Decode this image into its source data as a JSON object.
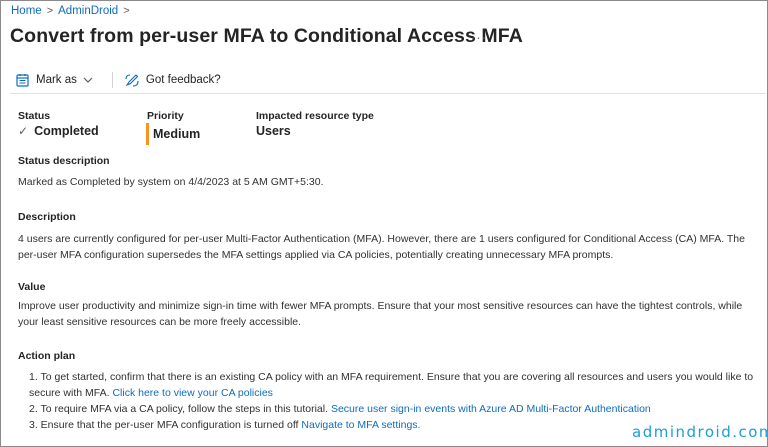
{
  "breadcrumb": {
    "items": [
      "Home",
      "AdminDroid"
    ],
    "separator": ">"
  },
  "header": {
    "title": "Convert from per-user MFA to Conditional Access MFA",
    "more_label": "···"
  },
  "toolbar": {
    "mark_as_label": "Mark as",
    "feedback_label": "Got feedback?"
  },
  "summary": {
    "status_label": "Status",
    "status_value": "Completed",
    "status_check": "✓",
    "priority_label": "Priority",
    "priority_value": "Medium",
    "priority_color": "#f7941d",
    "impacted_label": "Impacted resource type",
    "impacted_value": "Users"
  },
  "status_description": {
    "heading": "Status description",
    "text": "Marked as Completed by system on 4/4/2023 at 5 AM GMT+5:30."
  },
  "description": {
    "heading": "Description",
    "text": "4 users are currently configured for per-user Multi-Factor Authentication (MFA). However, there are 1 users configured for Conditional Access (CA) MFA. The per-user MFA configuration supersedes the MFA settings applied via CA policies, potentially creating unnecessary MFA prompts."
  },
  "value_section": {
    "heading": "Value",
    "text": "Improve user productivity and minimize sign-in time with fewer MFA prompts. Ensure that your most sensitive resources can have the tightest controls, while your least sensitive resources can be more freely accessible."
  },
  "action_plan": {
    "heading": "Action plan",
    "step1_text": "1. To get started, confirm that there is an existing CA policy with an MFA requirement. Ensure that you are covering all resources and users you would like to secure with MFA.",
    "step1_link": "Click here to view your CA policies",
    "step2_text": "2. To require MFA via a CA policy, follow the steps in this tutorial.",
    "step2_link": "Secure user sign-in events with Azure AD Multi-Factor Authentication",
    "step3_text": "3. Ensure that the per-user MFA configuration is turned off",
    "step3_link": "Navigate to MFA settings."
  },
  "watermark": {
    "text": "admindroid.com",
    "color": "#1a9fd6"
  }
}
